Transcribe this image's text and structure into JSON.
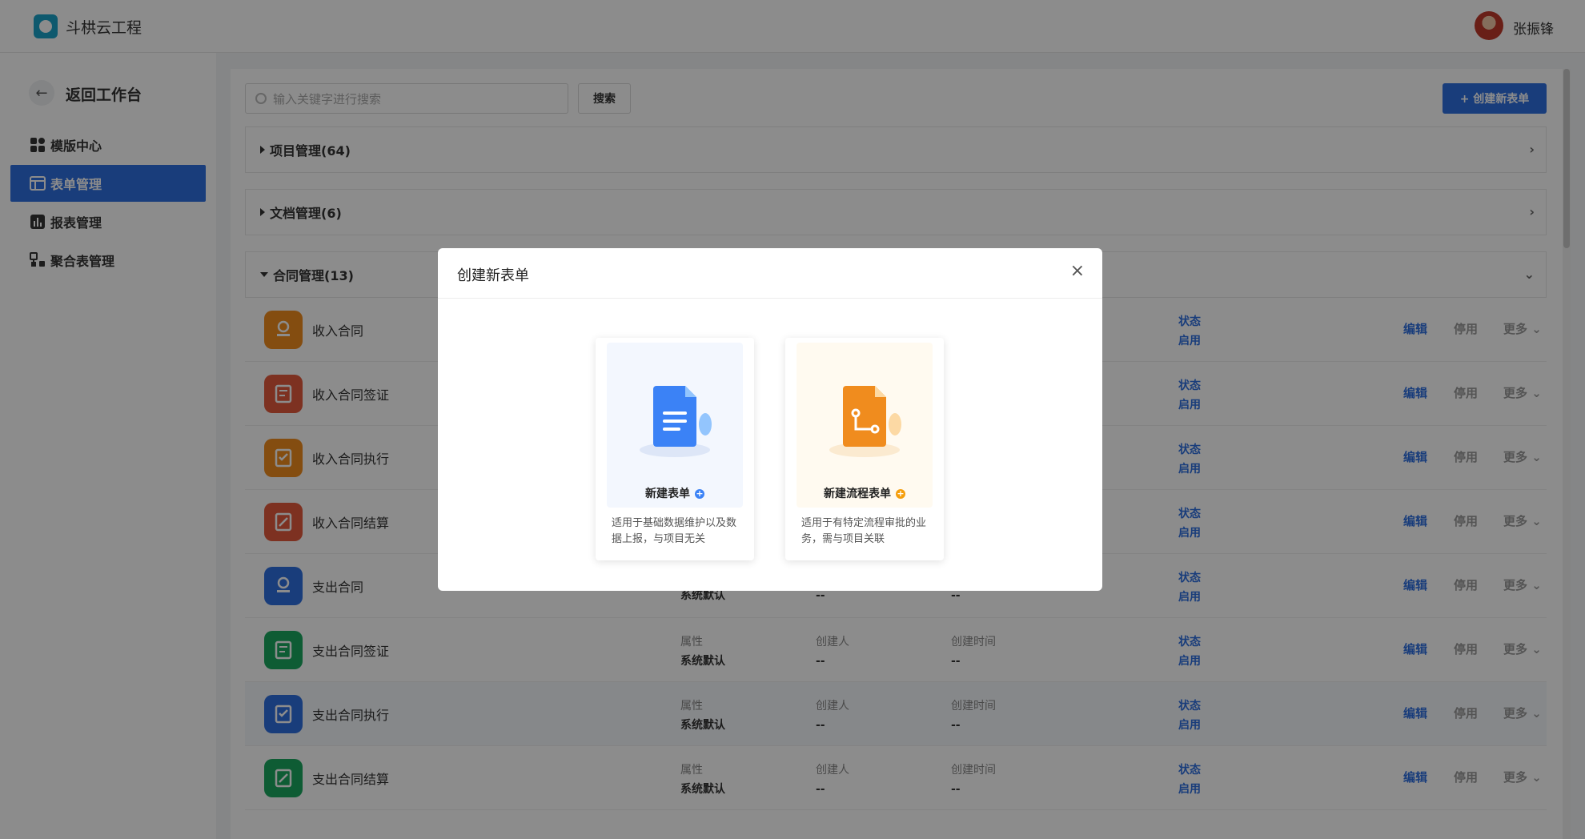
{
  "header": {
    "brand": "斗栱云工程",
    "user_name": "张振锋"
  },
  "sidebar": {
    "back_label": "返回工作台",
    "items": [
      {
        "label": "模版中心",
        "icon": "grid-icon"
      },
      {
        "label": "表单管理",
        "icon": "form-icon",
        "active": true
      },
      {
        "label": "报表管理",
        "icon": "chart-icon"
      },
      {
        "label": "聚合表管理",
        "icon": "aggregate-icon"
      }
    ]
  },
  "toolbar": {
    "search_placeholder": "输入关键字进行搜索",
    "search_button": "搜索",
    "create_button": "+ 创建新表单"
  },
  "groups": [
    {
      "label": "项目管理(64)",
      "expanded": false
    },
    {
      "label": "文档管理(6)",
      "expanded": false
    },
    {
      "label": "合同管理(13)",
      "expanded": true
    }
  ],
  "rows": [
    {
      "name": "收入合同",
      "status_label": "状态",
      "status": "启用"
    },
    {
      "name": "收入合同签证",
      "status_label": "状态",
      "status": "启用"
    },
    {
      "name": "收入合同执行",
      "status_label": "状态",
      "status": "启用"
    },
    {
      "name": "收入合同结算",
      "status_label": "状态",
      "status": "启用"
    },
    {
      "name": "支出合同",
      "prop": "系统默认",
      "creator": "--",
      "created": "--",
      "status_label": "状态",
      "status": "启用"
    },
    {
      "name": "支出合同签证",
      "prop_label": "属性",
      "prop": "系统默认",
      "creator_label": "创建人",
      "creator": "--",
      "created_label": "创建时间",
      "created": "--",
      "status_label": "状态",
      "status": "启用"
    },
    {
      "name": "支出合同执行",
      "prop_label": "属性",
      "prop": "系统默认",
      "creator_label": "创建人",
      "creator": "--",
      "created_label": "创建时间",
      "created": "--",
      "status_label": "状态",
      "status": "启用"
    },
    {
      "name": "支出合同结算",
      "prop_label": "属性",
      "prop": "系统默认",
      "creator_label": "创建人",
      "creator": "--",
      "created_label": "创建时间",
      "created": "--",
      "status_label": "状态",
      "status": "启用"
    }
  ],
  "row_actions": {
    "edit": "编辑",
    "disable": "停用",
    "more": "更多"
  },
  "modal": {
    "title": "创建新表单",
    "cards": [
      {
        "title": "新建表单",
        "desc": "适用于基础数据维护以及数据上报，与项目无关",
        "accent": "#3b82f6"
      },
      {
        "title": "新建流程表单",
        "desc": "适用于有特定流程审批的业务，需与项目关联",
        "accent": "#f59e0b"
      }
    ]
  },
  "colors": {
    "primary": "#2f6fe0",
    "orange": "#f08c1e",
    "red": "#e35a3c",
    "blue": "#2f6fe0",
    "green": "#1aa860"
  }
}
